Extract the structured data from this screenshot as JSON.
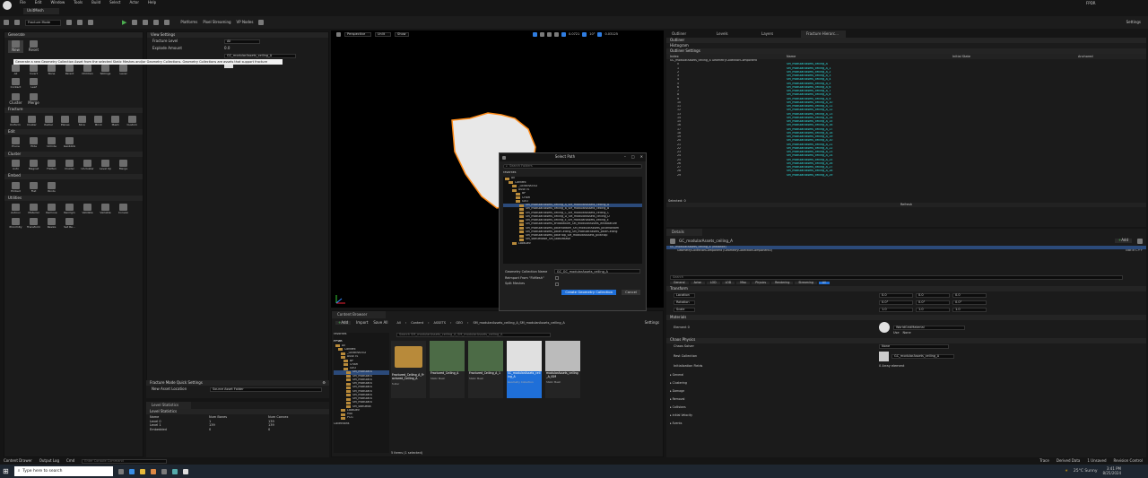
{
  "menubar": {
    "items": [
      "File",
      "Edit",
      "Window",
      "Tools",
      "Build",
      "Select",
      "Actor",
      "Help"
    ],
    "project": "FPDR",
    "window_title": "UnitMesh"
  },
  "toolbar": {
    "mode": "Fracture Mode",
    "platforms": "Platforms",
    "pixel_streaming": "Pixel Streaming",
    "vp_nodes": "VP Nodes",
    "settings": "Settings"
  },
  "fracture_panel": {
    "generate_header": "Generate",
    "generate_buttons": [
      "New",
      "Reset"
    ],
    "tooltip": "Generate a new Geometry Collection Asset from the selected Static Meshes and/or Geometry Collections. Geometry Collections are assets that support fracture",
    "cluster_buttons": [
      "Cluster",
      "Merge"
    ],
    "select_buttons": [
      "All",
      "Invert",
      "None",
      "Parent",
      "Children",
      "Siblings",
      "Level",
      "Contact",
      "Leaf"
    ],
    "fracture_header": "Fracture",
    "fracture_buttons": [
      "Uniform",
      "Cluster",
      "Radial",
      "Planes",
      "Slice",
      "Brick",
      "Mesh",
      "Custom"
    ],
    "edit_header": "Edit",
    "edit_buttons": [
      "Prune",
      "Hide",
      "Unhide",
      "Geoblink"
    ],
    "cluster_header": "Cluster",
    "cluster_tools": [
      "Auto",
      "Magnet",
      "Flatten",
      "Cluster",
      "Uncluster",
      "Level Up",
      "Merge"
    ],
    "embed_header": "Embed",
    "embed_buttons": [
      "Embed",
      "Flat",
      "Rinds"
    ],
    "utilities_header": "Utilities",
    "utilities_buttons": [
      "Autouv",
      "Material",
      "Remove",
      "Reorigin",
      "Validate",
      "Variable",
      "Convex",
      "Proximity",
      "Transform",
      "Resize",
      "Set Re..."
    ]
  },
  "view_settings": {
    "header": "View Settings",
    "fracture_level_label": "Fracture Level",
    "fracture_level_value": "All",
    "explode_label": "Explode Amount",
    "explode_value": "0.0",
    "collection_label": "Collection",
    "collection_value": "GC_modularAssets_ceiling_A",
    "new_collection_label": "Next Collection"
  },
  "quick_settings": {
    "header": "Fracture Mode Quick Settings",
    "location_label": "New Asset Location",
    "location_value": "Source Asset Folder"
  },
  "level_stats": {
    "tab": "Level Statistics",
    "header": "Level Statistics",
    "columns": [
      "Name",
      "Num Bones",
      "Num Convex"
    ],
    "rows": [
      [
        "Level 0",
        "1",
        "139"
      ],
      [
        "Level 1",
        "139",
        "139"
      ],
      [
        "Embedded",
        "0",
        "0"
      ]
    ]
  },
  "viewport": {
    "perspective": "Perspective",
    "lit": "Unlit",
    "show": "Show",
    "grid_value": "0.0721",
    "angle_value": "10°",
    "scale_value": "0.03125"
  },
  "dialog": {
    "title": "Select Path",
    "search_placeholder": "Search Folders",
    "favorites": "Favorites",
    "tree": [
      {
        "label": "All",
        "indent": 0
      },
      {
        "label": "Content",
        "indent": 1
      },
      {
        "label": "_GENERATED",
        "indent": 2
      },
      {
        "label": "ASSETS",
        "indent": 2
      },
      {
        "label": "BP",
        "indent": 3
      },
      {
        "label": "CHAR",
        "indent": 3
      },
      {
        "label": "GEO",
        "indent": 3
      },
      {
        "label": "SM_modularAssets_ceiling_A_SM_modularAssets_ceiling_A",
        "indent": 4,
        "selected": true
      },
      {
        "label": "SM_modularAssets_ceiling_B_SM_modularAssets_ceiling_B",
        "indent": 4
      },
      {
        "label": "SM_modularAssets_ceiling_C_SM_modularAssets_ceiling_C",
        "indent": 4
      },
      {
        "label": "SM_modularAssets_ceiling_D_SM_modularAssets_ceiling_D",
        "indent": 4
      },
      {
        "label": "SM_modularAssets_ceiling_E_SM_modularAssets_ceiling_E",
        "indent": 4
      },
      {
        "label": "SM_modularAssets_entablature_SM_modularAssets_entablature",
        "indent": 4
      },
      {
        "label": "SM_modularAssets_pillarBottom_SM_modularAssets_pillarBottom",
        "indent": 4
      },
      {
        "label": "SM_modularAssets_pillarCeiling_SM_modularAssets_pillarCeiling",
        "indent": 4
      },
      {
        "label": "SM_modularAssets_pillarTop_SM_modularAssets_pillarTop",
        "indent": 4
      },
      {
        "label": "SM_statueBase_SM_statueBase",
        "indent": 4
      },
      {
        "label": "LookDev",
        "indent": 2
      }
    ],
    "name_label": "Geometry Collection Name",
    "name_value": "GC_GC_modularAssets_ceiling_A",
    "reimport_label": "Reimport From \"FbMesh\"",
    "split_label": "Split Meshes",
    "create_button": "Create Geometry Collection",
    "cancel_button": "Cancel"
  },
  "content_browser": {
    "tab": "Content Browser",
    "add": "Add",
    "import": "Import",
    "save_all": "Save All",
    "breadcrumb": [
      "All",
      "Content",
      "ASSETS",
      "GEO",
      "SM_modularAssets_ceiling_A_SM_modularAssets_ceiling_A"
    ],
    "settings": "Settings",
    "favorites": "Favorites",
    "root": "FPDR",
    "search_placeholder": "Search SM_modularAssets_ceiling_A_SM_modularAssets_ceiling_A",
    "tree": [
      {
        "label": "All",
        "indent": 0
      },
      {
        "label": "Content",
        "indent": 1
      },
      {
        "label": "_GENERATED",
        "indent": 2
      },
      {
        "label": "ASSETS",
        "indent": 2
      },
      {
        "label": "BP",
        "indent": 3
      },
      {
        "label": "CHAR",
        "indent": 3
      },
      {
        "label": "GEO",
        "indent": 3
      },
      {
        "label": "SM_modularA",
        "indent": 4,
        "selected": true
      },
      {
        "label": "SM_modularA",
        "indent": 4
      },
      {
        "label": "SM_modularA",
        "indent": 4
      },
      {
        "label": "SM_modularA",
        "indent": 4
      },
      {
        "label": "SM_modularA",
        "indent": 4
      },
      {
        "label": "SM_modularA",
        "indent": 4
      },
      {
        "label": "SM_modularA",
        "indent": 4
      },
      {
        "label": "SM_modularA",
        "indent": 4
      },
      {
        "label": "SM_modularA",
        "indent": 4
      },
      {
        "label": "SM_statueBa",
        "indent": 4
      },
      {
        "label": "LookDev",
        "indent": 2
      },
      {
        "label": "MAT",
        "indent": 2
      },
      {
        "label": "PCG",
        "indent": 2
      }
    ],
    "assets": [
      {
        "name": "Fractured_Ceiling_A_Fractured_Ceiling_A",
        "type": "folder"
      },
      {
        "name": "Fractured_Ceiling_A",
        "type": "Static Mesh"
      },
      {
        "name": "Fractured_Ceiling_A_1",
        "type": "Static Mesh"
      },
      {
        "name": "SC_modularAssets_ceiling_A",
        "type": "Geometry Collection"
      },
      {
        "name": "modularAssets_ceiling_A_ISM",
        "type": "Static Mesh"
      }
    ],
    "collections": "Collections",
    "status": "5 items (1 selected)"
  },
  "outliner": {
    "tabs": [
      "Outliner",
      "Levels",
      "Layers",
      "Fracture Hierarc..."
    ],
    "sub": [
      "Outliner",
      "Histogram",
      "Outliner Settings"
    ],
    "columns": [
      "Index",
      "Name",
      "Initial State",
      "Anchored"
    ],
    "rows": [
      [
        "0",
        "SM_modularAssets_ceiling_A"
      ],
      [
        "1",
        "SM_modularAssets_ceiling_A_1"
      ],
      [
        "2",
        "SM_modularAssets_ceiling_A_2"
      ],
      [
        "3",
        "SM_modularAssets_ceiling_A_3"
      ],
      [
        "4",
        "SM_modularAssets_ceiling_A_4"
      ],
      [
        "5",
        "SM_modularAssets_ceiling_A_5"
      ],
      [
        "6",
        "SM_modularAssets_ceiling_A_6"
      ],
      [
        "7",
        "SM_modularAssets_ceiling_A_7"
      ],
      [
        "8",
        "SM_modularAssets_ceiling_A_8"
      ],
      [
        "9",
        "SM_modularAssets_ceiling_A_9"
      ],
      [
        "10",
        "SM_modularAssets_ceiling_A_10"
      ],
      [
        "11",
        "SM_modularAssets_ceiling_A_11"
      ],
      [
        "12",
        "SM_modularAssets_ceiling_A_12"
      ],
      [
        "13",
        "SM_modularAssets_ceiling_A_13"
      ],
      [
        "14",
        "SM_modularAssets_ceiling_A_14"
      ],
      [
        "15",
        "SM_modularAssets_ceiling_A_15"
      ],
      [
        "16",
        "SM_modularAssets_ceiling_A_16"
      ],
      [
        "17",
        "SM_modularAssets_ceiling_A_17"
      ],
      [
        "18",
        "SM_modularAssets_ceiling_A_18"
      ],
      [
        "19",
        "SM_modularAssets_ceiling_A_19"
      ],
      [
        "20",
        "SM_modularAssets_ceiling_A_20"
      ],
      [
        "21",
        "SM_modularAssets_ceiling_A_21"
      ],
      [
        "22",
        "SM_modularAssets_ceiling_A_22"
      ],
      [
        "23",
        "SM_modularAssets_ceiling_A_23"
      ],
      [
        "24",
        "SM_modularAssets_ceiling_A_24"
      ],
      [
        "25",
        "SM_modularAssets_ceiling_A_25"
      ],
      [
        "26",
        "SM_modularAssets_ceiling_A_26"
      ],
      [
        "27",
        "SM_modularAssets_ceiling_A_27"
      ],
      [
        "28",
        "SM_modularAssets_ceiling_A_28"
      ],
      [
        "29",
        "SM_modularAssets_ceiling_A_29"
      ]
    ],
    "root": "GC_modularAssets_ceiling_A GeometryCollectionComponent",
    "selected": "Selected: 0",
    "refresh": "Refresh"
  },
  "details": {
    "tab": "Details",
    "actor": "GC_modularAssets_ceiling_A",
    "add": "Add",
    "instance": "GC_modularAssets_ceiling_A (Instance)",
    "component": "GeometryCollectionComponent (GeometryCollectionComponent0)",
    "edit_in": "Edit in C++",
    "search_placeholder": "Search",
    "filter_tabs": [
      "General",
      "Actor",
      "LOD",
      "LOD",
      "Misc",
      "Physics",
      "Rendering",
      "Streaming",
      "All"
    ],
    "transform_header": "Transform",
    "location_label": "Location",
    "rotation_label": "Rotation",
    "scale_label": "Scale",
    "location": [
      "0.0",
      "0.0",
      "0.0"
    ],
    "rotation": [
      "0.0°",
      "0.0°",
      "0.0°"
    ],
    "scale": [
      "1.0",
      "1.0",
      "1.0"
    ],
    "materials_header": "Materials",
    "element_label": "Element 0",
    "material_value": "WorldGridMaterial",
    "material_source": "Use",
    "material_none": "None",
    "chaos_header": "Chaos Physics",
    "chaos_solver_label": "Chaos Solver",
    "chaos_solver_value": "None",
    "rest_collection_label": "Rest Collection",
    "rest_collection_value": "GC_modularAssets_ceiling_A",
    "init_fields_label": "Initialization Fields",
    "init_fields_value": "0 Array element",
    "groups": [
      "General",
      "Clustering",
      "Damage",
      "Removal",
      "Collisions",
      "Initial Velocity",
      "Events"
    ]
  },
  "statusbar": {
    "content_drawer": "Content Drawer",
    "output_log": "Output Log",
    "cmd": "Cmd",
    "cmd_placeholder": "Enter Console Command",
    "trace": "Trace",
    "derived": "Derived Data",
    "unsaved": "1 Unsaved",
    "revision": "Revision Control"
  },
  "taskbar": {
    "search": "Type here to search",
    "weather": "25°C Sunny",
    "time": "3:41 PM",
    "date": "8/25/2024"
  }
}
